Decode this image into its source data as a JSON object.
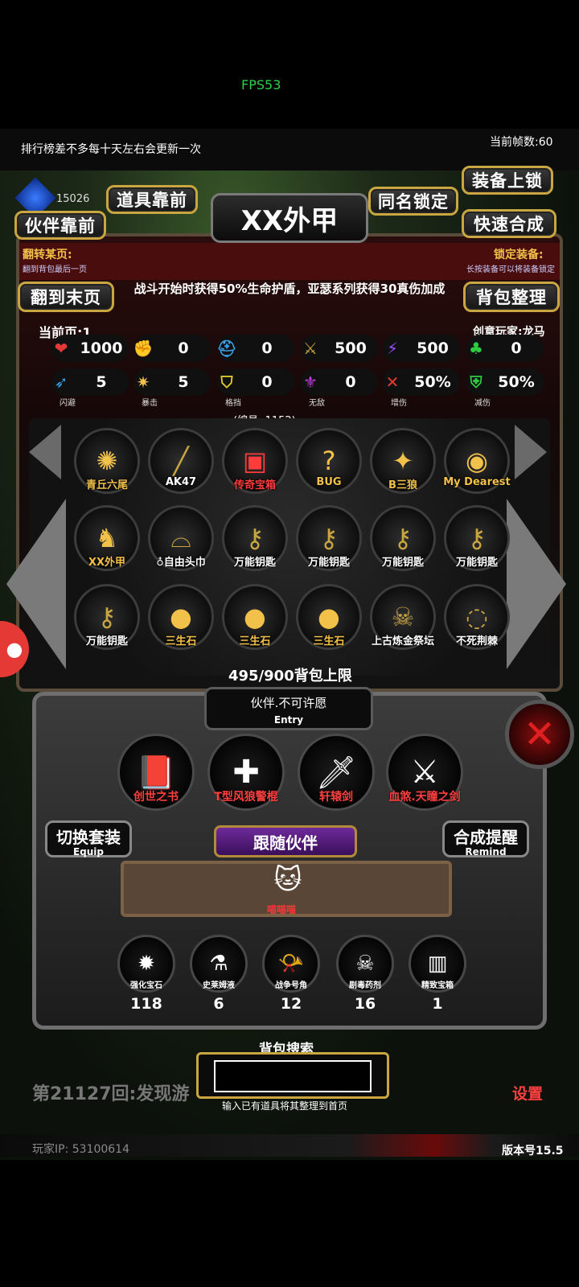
{
  "fps": "FPS53",
  "rank_note": "排行榜差不多每十天左右会更新一次",
  "frame_count": "当前帧数:60",
  "gem_value": "15026",
  "buttons": {
    "equip_lock": "装备上锁",
    "item_front": "道具靠前",
    "same_name_lock": "同名锁定",
    "partner_front": "伙伴靠前",
    "quick_craft": "快速合成",
    "to_last_page": "翻到末页",
    "bag_sort": "背包整理"
  },
  "item_title": "XX外甲",
  "flip_label": "翻转某页:",
  "flip_sub": "翻到背包最后一页",
  "lock_label": "锁定装备:",
  "lock_sub": "长按装备可以将装备锁定",
  "description": "战斗开始时获得50%生命护盾，亚瑟系列获得30真伤加成",
  "current_page": "当前页:1",
  "creator": "创意玩家:龙马",
  "stats_row1": [
    {
      "icon": "heart-icon",
      "symbol": "❤",
      "color": "#e53935",
      "value": "1000"
    },
    {
      "icon": "strength-icon",
      "symbol": "✊",
      "color": "#f2c14a",
      "value": "0"
    },
    {
      "icon": "helmet-icon",
      "symbol": "⛑",
      "color": "#3aa0e8",
      "value": "0"
    },
    {
      "icon": "sword-icon",
      "symbol": "⚔",
      "color": "#c9a640",
      "value": "500"
    },
    {
      "icon": "lightning-icon",
      "symbol": "⚡",
      "color": "#9b4dff",
      "value": "500"
    },
    {
      "icon": "clover-icon",
      "symbol": "♣",
      "color": "#2ecc40",
      "value": "0"
    }
  ],
  "stats_row2": [
    {
      "icon": "dodge-icon",
      "symbol": "➶",
      "color": "#3aa0e8",
      "value": "5",
      "name": "闪避"
    },
    {
      "icon": "crit-icon",
      "symbol": "✷",
      "color": "#f2c14a",
      "value": "5",
      "name": "暴击"
    },
    {
      "icon": "block-icon",
      "symbol": "⛉",
      "color": "#e6d12a",
      "value": "0",
      "name": "格挡"
    },
    {
      "icon": "invincible-icon",
      "symbol": "⚜",
      "color": "#c040e0",
      "value": "0",
      "name": "无敌"
    },
    {
      "icon": "damage-up-icon",
      "symbol": "✕",
      "color": "#e53935",
      "value": "50%",
      "name": "增伤"
    },
    {
      "icon": "damage-down-icon",
      "symbol": "⛨",
      "color": "#2ecc40",
      "value": "50%",
      "name": "减伤"
    }
  ],
  "id_line": "(编号: 1152)",
  "items": [
    {
      "label": "青丘六尾",
      "color": "#f2c14a",
      "icon": "fox-icon",
      "symbol": "✺"
    },
    {
      "label": "AK47",
      "color": "#ffffff",
      "icon": "rifle-icon",
      "symbol": "╱"
    },
    {
      "label": "传奇宝箱",
      "color": "#ff3b3b",
      "icon": "chest-icon",
      "symbol": "▣"
    },
    {
      "label": "BUG",
      "color": "#f2c14a",
      "icon": "bug-icon",
      "symbol": "?"
    },
    {
      "label": "B三狼",
      "color": "#f2c14a",
      "icon": "wolf-icon",
      "symbol": "✦"
    },
    {
      "label": "My Dearest",
      "color": "#f2c14a",
      "icon": "orb-icon",
      "symbol": "◉"
    },
    {
      "label": "XX外甲",
      "color": "#f2c14a",
      "icon": "armor-icon",
      "symbol": "♞"
    },
    {
      "label": "♁自由头巾",
      "color": "#ffffff",
      "icon": "scarf-icon",
      "symbol": "⌓"
    },
    {
      "label": "万能钥匙",
      "color": "#ffffff",
      "icon": "key-icon",
      "symbol": "⚷"
    },
    {
      "label": "万能钥匙",
      "color": "#ffffff",
      "icon": "key-icon",
      "symbol": "⚷"
    },
    {
      "label": "万能钥匙",
      "color": "#ffffff",
      "icon": "key-icon",
      "symbol": "⚷"
    },
    {
      "label": "万能钥匙",
      "color": "#ffffff",
      "icon": "key-icon",
      "symbol": "⚷"
    },
    {
      "label": "万能钥匙",
      "color": "#ffffff",
      "icon": "key-icon",
      "symbol": "⚷"
    },
    {
      "label": "三生石",
      "color": "#f2c14a",
      "icon": "stone-icon",
      "symbol": "●"
    },
    {
      "label": "三生石",
      "color": "#f2c14a",
      "icon": "stone-icon",
      "symbol": "●"
    },
    {
      "label": "三生石",
      "color": "#f2c14a",
      "icon": "stone-icon",
      "symbol": "●"
    },
    {
      "label": "上古炼金祭坛",
      "color": "#ffffff",
      "icon": "skull-altar-icon",
      "symbol": "☠"
    },
    {
      "label": "不死荆棘",
      "color": "#ffffff",
      "icon": "thorn-ring-icon",
      "symbol": "◌"
    }
  ],
  "capacity": "495/900背包上限",
  "entry": {
    "title": "伙伴.不可许愿",
    "sub": "Entry"
  },
  "partners": [
    {
      "label": "创世之书",
      "icon": "book-icon",
      "symbol": "📕"
    },
    {
      "label": "T型风狼警棍",
      "icon": "baton-icon",
      "symbol": "✚"
    },
    {
      "label": "轩辕剑",
      "icon": "sword-icon",
      "symbol": "🗡"
    },
    {
      "label": "血煞.天瞳之剑",
      "icon": "blood-sword-icon",
      "symbol": "⚔"
    }
  ],
  "switch_set": {
    "main": "切换套装",
    "sub": "Equip"
  },
  "craft_remind": {
    "main": "合成提醒",
    "sub": "Remind"
  },
  "follow_partner": "跟随伙伴",
  "pet_label": "喵喵喵",
  "materials": [
    {
      "name": "强化宝石",
      "count": "118",
      "icon": "gem-green-icon",
      "symbol": "✹"
    },
    {
      "name": "史莱姆液",
      "count": "6",
      "icon": "potion-icon",
      "symbol": "⚗"
    },
    {
      "name": "战争号角",
      "count": "12",
      "icon": "horn-icon",
      "symbol": "📯"
    },
    {
      "name": "剧毒药剂",
      "count": "16",
      "icon": "poison-icon",
      "symbol": "☠"
    },
    {
      "name": "精致宝箱",
      "count": "1",
      "icon": "fine-chest-icon",
      "symbol": "▥"
    }
  ],
  "search": {
    "title": "背包搜索",
    "placeholder": "",
    "hint": "输入已有道具将其整理到首页"
  },
  "round_log": "第21127回:发现游",
  "player_ip": "玩家IP: 53100614",
  "version": "版本号15.5",
  "settings": "设置"
}
